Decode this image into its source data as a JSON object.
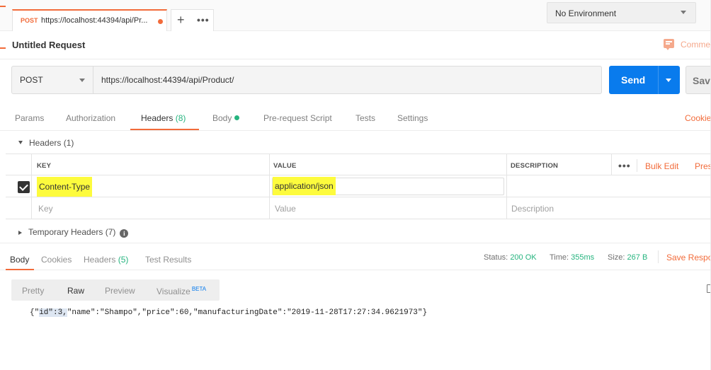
{
  "tab": {
    "method": "POST",
    "title": "https://localhost:44394/api/Pr...",
    "new_tab": "+",
    "more": "•••"
  },
  "environment": {
    "selected": "No Environment"
  },
  "request": {
    "name": "Untitled Request",
    "comments_label": "Comme",
    "method": "POST",
    "url": "https://localhost:44394/api/Product/",
    "send_label": "Send",
    "save_label": "Save"
  },
  "request_tabs": [
    {
      "label": "Params"
    },
    {
      "label": "Authorization"
    },
    {
      "label": "Headers",
      "count": "(8)"
    },
    {
      "label": "Body"
    },
    {
      "label": "Pre-request Script"
    },
    {
      "label": "Tests"
    },
    {
      "label": "Settings"
    }
  ],
  "cookies_label": "Cookie",
  "headers_section": {
    "title": "Headers (1)",
    "columns": {
      "key": "KEY",
      "value": "VALUE",
      "description": "DESCRIPTION"
    },
    "more": "•••",
    "bulk_edit": "Bulk Edit",
    "presets": "Pres",
    "rows": [
      {
        "checked": true,
        "key": "Content-Type",
        "value": "application/json",
        "description": ""
      }
    ],
    "placeholders": {
      "key": "Key",
      "value": "Value",
      "description": "Description"
    }
  },
  "temporary_headers": {
    "title": "Temporary Headers (7)",
    "info": "i"
  },
  "response_tabs": [
    {
      "label": "Body"
    },
    {
      "label": "Cookies"
    },
    {
      "label": "Headers",
      "count": "(5)"
    },
    {
      "label": "Test Results"
    }
  ],
  "response_status": {
    "status_label": "Status:",
    "status_value": "200 OK",
    "time_label": "Time:",
    "time_value": "355ms",
    "size_label": "Size:",
    "size_value": "267 B",
    "save_response": "Save Respo"
  },
  "view_modes": {
    "pretty": "Pretty",
    "raw": "Raw",
    "preview": "Preview",
    "visualize": "Visualize",
    "beta": "BETA",
    "selected": "Raw"
  },
  "response_body": {
    "prefix": "{\"",
    "selected": "id\":3,",
    "rest": "\"name\":\"Shampo\",\"price\":60,\"manufacturingDate\":\"2019-11-28T17:27:34.9621973\"}"
  },
  "colors": {
    "accent": "#f26b3a",
    "send": "#097bed",
    "success": "#26b47f",
    "highlight": "#fdfb3d"
  }
}
